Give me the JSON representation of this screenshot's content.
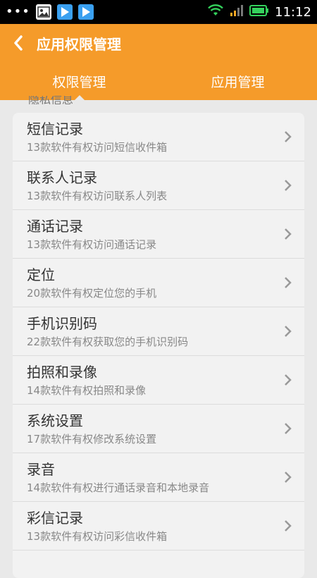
{
  "status_bar": {
    "dots": "•••",
    "time": "11:12"
  },
  "header": {
    "title": "应用权限管理"
  },
  "tabs": [
    {
      "label": "权限管理",
      "active": true
    },
    {
      "label": "应用管理",
      "active": false
    }
  ],
  "peek_text": "隐私信息",
  "permissions": [
    {
      "title": "短信记录",
      "desc": "13款软件有权访问短信收件箱"
    },
    {
      "title": "联系人记录",
      "desc": "13款软件有权访问联系人列表"
    },
    {
      "title": "通话记录",
      "desc": "13款软件有权访问通话记录"
    },
    {
      "title": "定位",
      "desc": "20款软件有权定位您的手机"
    },
    {
      "title": "手机识别码",
      "desc": "22款软件有权获取您的手机识别码"
    },
    {
      "title": "拍照和录像",
      "desc": "14款软件有权拍照和录像"
    },
    {
      "title": "系统设置",
      "desc": "17款软件有权修改系统设置"
    },
    {
      "title": "录音",
      "desc": "14款软件有权进行通话录音和本地录音"
    },
    {
      "title": "彩信记录",
      "desc": "13款软件有权访问彩信收件箱"
    }
  ],
  "colors": {
    "accent": "#f59b2a",
    "battery": "#34d15c",
    "wifi": "#34d15c"
  }
}
